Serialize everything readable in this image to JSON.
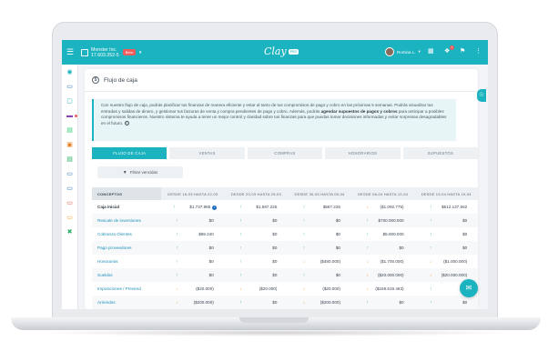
{
  "topbar": {
    "company_name": "Monster Inc.",
    "company_id": "17.603.352-5",
    "company_badge": "Beta",
    "logo": "Clay",
    "logo_badge": "PRO",
    "user_name": "Romina L.",
    "icons": [
      "menu-icon",
      "building-icon",
      "grid-icon",
      "gift-icon",
      "bell-icon",
      "more-icon"
    ],
    "notification_count": "1"
  },
  "sidebar": {
    "items": [
      "chart-icon",
      "document-icon",
      "file-icon",
      "card-icon",
      "receipt-icon",
      "briefcase-icon",
      "list-icon",
      "invoice-icon",
      "invoice-icon",
      "document-icon",
      "tools-icon"
    ]
  },
  "page": {
    "title": "Flujo de caja",
    "info_text_1": "Con nuestro flujo de caja, podrás planificar tus finanzas de manera eficiente y estar al tanto de tus compromisos de pago y cobro en las próximas 5 semanas. Podrás visualizar tus entradas y salidas de dinero, y gestionar tus facturas de venta y compra pendientes de pago y cobro. Además, podrás ",
    "info_bold": "agendar supuestos de pagos y cobros",
    "info_text_2": " para anticipar a posibles compromisos financieros. Nuestro sistema te ayuda a tener un mejor control y claridad sobre tus finanzas para que puedas tomar decisiones informadas y evitar sorpresas desagradables en el futuro.",
    "help_symbol": "?"
  },
  "tabs": [
    {
      "label": "FLUJO DE CAJA",
      "active": true
    },
    {
      "label": "VENTAS",
      "active": false
    },
    {
      "label": "COMPRAS",
      "active": false
    },
    {
      "label": "HONORARIOS",
      "active": false
    },
    {
      "label": "SUPUESTOS",
      "active": false
    }
  ],
  "filter_label": "Filtrar vencidas",
  "table": {
    "headers": [
      "CONCEPTOS",
      "DESDE 16-03 HASTA 22-03",
      "DESDE 23-03 HASTA 29-03",
      "DESDE 30-03 HASTA 05-04",
      "DESDE 06-04 HASTA 12-04",
      "DESDE 13-04 HASTA 19-04"
    ],
    "rows": [
      {
        "concept": "Caja inicial",
        "strong": true,
        "cells": [
          [
            "up",
            "$1.737.985"
          ],
          [
            "up",
            "$1.587.225"
          ],
          [
            "up",
            "$567.225"
          ],
          [
            "down",
            "($1.092.775)"
          ],
          [
            "up",
            "$512.137.562"
          ]
        ]
      },
      {
        "concept": "Rescate de inversiones",
        "strong": false,
        "cells": [
          [
            "up",
            "$0"
          ],
          [
            "up",
            "$0"
          ],
          [
            "up",
            "$0"
          ],
          [
            "up",
            "$700.000.000"
          ],
          [
            "up",
            "$0"
          ]
        ]
      },
      {
        "concept": "Cobranza Clientes",
        "strong": false,
        "cells": [
          [
            "up",
            "$69.240"
          ],
          [
            "up",
            "$0"
          ],
          [
            "up",
            "$0"
          ],
          [
            "up",
            "$5.000.000"
          ],
          [
            "up",
            "$0"
          ]
        ]
      },
      {
        "concept": "Pago proveedores",
        "strong": false,
        "cells": [
          [
            "up",
            "$0"
          ],
          [
            "up",
            "$0"
          ],
          [
            "up",
            "$0"
          ],
          [
            "up",
            "$0"
          ],
          [
            "up",
            "$0"
          ]
        ]
      },
      {
        "concept": "Honorarios",
        "strong": false,
        "cells": [
          [
            "up",
            "$0"
          ],
          [
            "up",
            "$0"
          ],
          [
            "down",
            "($480.000)"
          ],
          [
            "down",
            "($1.700.000)"
          ],
          [
            "down",
            "($1.000.000)"
          ]
        ]
      },
      {
        "concept": "Sueldos",
        "strong": false,
        "cells": [
          [
            "up",
            "$0"
          ],
          [
            "up",
            "$0"
          ],
          [
            "up",
            "$0"
          ],
          [
            "down",
            "($20.000.000)"
          ],
          [
            "down",
            "($20.000.000)"
          ]
        ]
      },
      {
        "concept": "Imposiciones / Previred",
        "strong": false,
        "cells": [
          [
            "down",
            "($20.000)"
          ],
          [
            "down",
            "($20.000)"
          ],
          [
            "down",
            "($20.000)"
          ],
          [
            "down",
            "($169.619.463)"
          ],
          [
            "up",
            "$0"
          ]
        ]
      },
      {
        "concept": "Arriendos",
        "strong": false,
        "cells": [
          [
            "down",
            "($200.000)"
          ],
          [
            "up",
            "$0"
          ],
          [
            "down",
            "($200.000)"
          ],
          [
            "up",
            "$0"
          ],
          [
            "up",
            "$0"
          ]
        ]
      }
    ]
  },
  "colors": {
    "accent": "#1bb3bf",
    "up": "#3cb371",
    "down": "#f0a030",
    "link": "#1f8fb8"
  }
}
